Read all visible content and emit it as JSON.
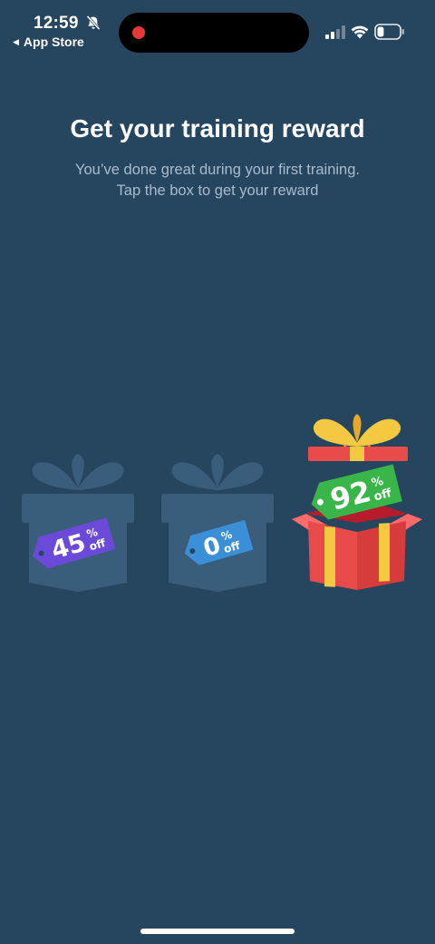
{
  "status_bar": {
    "time": "12:59",
    "back_label": "App Store",
    "battery_level": 0.3
  },
  "screen": {
    "title": "Get your training reward",
    "subtitle_line1": "You’ve done great during your first training.",
    "subtitle_line2": "Tap the box to get your reward"
  },
  "boxes": [
    {
      "value": "45",
      "percent": "%",
      "off": "off",
      "state": "closed",
      "tag_color": "#6c4ad9"
    },
    {
      "value": "0",
      "percent": "%",
      "off": "off",
      "state": "closed",
      "tag_color": "#3b8fd6"
    },
    {
      "value": "92",
      "percent": "%",
      "off": "off",
      "state": "opened",
      "tag_color": "#3ab54a"
    }
  ],
  "colors": {
    "background": "#26455f",
    "closed_box": "#3a5d7b",
    "gift_red": "#e94b4b",
    "ribbon_yellow": "#f5c842"
  }
}
